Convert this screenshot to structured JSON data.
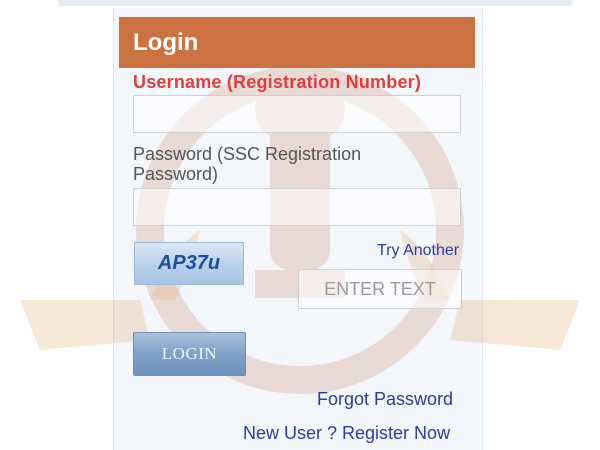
{
  "header": {
    "title": "Login"
  },
  "form": {
    "username_label": "Username (Registration Number)",
    "username_value": "",
    "password_label": "Password (SSC Registration Password)",
    "password_value": "",
    "captcha_text": "AP37u",
    "try_another_label": "Try Another",
    "captcha_placeholder": "ENTER TEXT",
    "login_label": "LOGIN",
    "forgot_password_label": "Forgot Password",
    "register_label": "New User ? Register Now"
  },
  "colors": {
    "header_bg": "#cc7240",
    "username_label": "#e23d3d",
    "link": "#2d3b9c",
    "button": "#7e9fc7"
  }
}
